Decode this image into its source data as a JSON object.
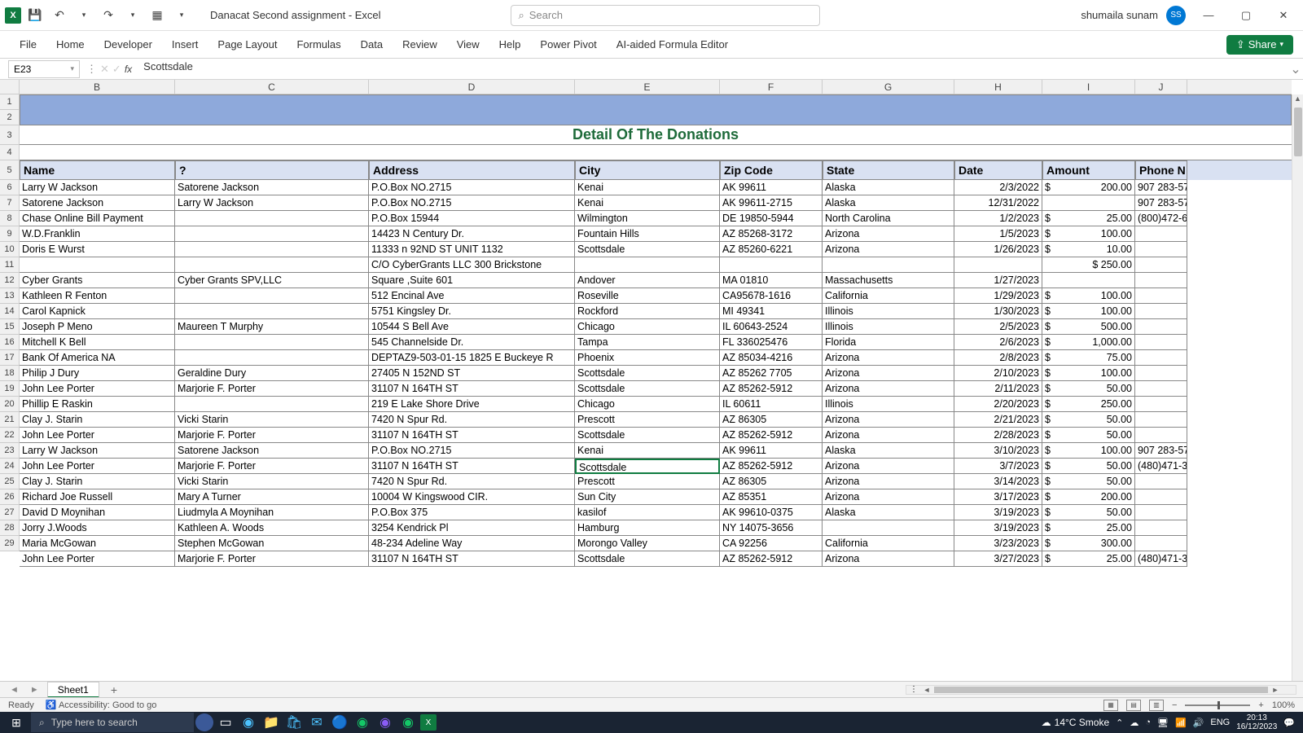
{
  "title_bar": {
    "doc_title": "Danacat Second assignment  -  Excel",
    "search_placeholder": "Search",
    "user_name": "shumaila sunam",
    "avatar": "SS"
  },
  "ribbon_tabs": [
    "File",
    "Home",
    "Developer",
    "Insert",
    "Page Layout",
    "Formulas",
    "Data",
    "Review",
    "View",
    "Help",
    "Power Pivot",
    "AI-aided Formula Editor"
  ],
  "share_label": "Share",
  "name_box": "E23",
  "formula_value": "Scottsdale",
  "col_letters": [
    "B",
    "C",
    "D",
    "E",
    "F",
    "G",
    "H",
    "I",
    "J"
  ],
  "sheet_title": "Detail Of The Donations",
  "headers": [
    "Name",
    "?",
    "Address",
    "City",
    "Zip Code",
    "State",
    "Date",
    "Amount",
    "Phone N"
  ],
  "rows": [
    {
      "r": 6,
      "name": "Larry W Jackson",
      "c2": "Satorene Jackson",
      "addr": "P.O.Box NO.2715",
      "city": "Kenai",
      "zip": "AK 99611",
      "state": "Alaska",
      "date": "2/3/2022",
      "amt": "200.00",
      "phone": "907 283-57"
    },
    {
      "r": 7,
      "name": "Satorene Jackson",
      "c2": "Larry W Jackson",
      "addr": "P.O.Box NO.2715",
      "city": "Kenai",
      "zip": "AK 99611-2715",
      "state": "Alaska",
      "date": "12/31/2022",
      "amt": "",
      "phone": "907 283-57"
    },
    {
      "r": 8,
      "name": "Chase Online Bill Payment",
      "c2": "",
      "addr": "P.O.Box 15944",
      "city": "Wilmington",
      "zip": "DE 19850-5944",
      "state": "North Carolina",
      "date": "1/2/2023",
      "amt": "25.00",
      "phone": "(800)472-6"
    },
    {
      "r": 9,
      "name": "W.D.Franklin",
      "c2": "",
      "addr": "14423 N  Century Dr.",
      "city": "Fountain Hills",
      "zip": "AZ 85268-3172",
      "state": "Arizona",
      "date": "1/5/2023",
      "amt": "100.00",
      "phone": ""
    },
    {
      "r": 10,
      "name": "Doris E Wurst",
      "c2": "",
      "addr": "11333 n 92ND ST UNIT 1132",
      "city": "Scottsdale",
      "zip": "AZ 85260-6221",
      "state": "Arizona",
      "date": "1/26/2023",
      "amt": "10.00",
      "phone": ""
    },
    {
      "r": 11,
      "name": "Cyber Grants",
      "c2": "Cyber Grants SPV,LLC",
      "addr": "C/O CyberGrants LLC 300 Brickstone Square ,Suite 601",
      "city": "Andover",
      "zip": "MA 01810",
      "state": "Massachusetts",
      "date": "1/27/2023",
      "amt": "250.00",
      "phone": "",
      "tall": true,
      "amt_row_above": true
    },
    {
      "r": 12,
      "name": "Kathleen R Fenton",
      "c2": "",
      "addr": "512 Encinal Ave",
      "city": "Roseville",
      "zip": "CA95678-1616",
      "state": "California",
      "date": "1/29/2023",
      "amt": "100.00",
      "phone": ""
    },
    {
      "r": 13,
      "name": "Carol Kapnick",
      "c2": "",
      "addr": "5751 Kingsley Dr.",
      "city": "Rockford",
      "zip": "MI 49341",
      "state": "Illinois",
      "date": "1/30/2023",
      "amt": "100.00",
      "phone": ""
    },
    {
      "r": 14,
      "name": "Joseph P Meno",
      "c2": "Maureen T Murphy",
      "addr": "10544 S Bell Ave",
      "city": "Chicago",
      "zip": "IL 60643-2524",
      "state": "Illinois",
      "date": "2/5/2023",
      "amt": "500.00",
      "phone": ""
    },
    {
      "r": 15,
      "name": "Mitchell K Bell",
      "c2": "",
      "addr": "545 Channelside Dr.",
      "city": "Tampa",
      "zip": "FL 336025476",
      "state": "Florida",
      "date": "2/6/2023",
      "amt": "1,000.00",
      "phone": ""
    },
    {
      "r": 16,
      "name": "Bank Of America NA",
      "c2": "",
      "addr": "DEPTAZ9-503-01-15 1825 E Buckeye R",
      "city": "Phoenix",
      "zip": "AZ 85034-4216",
      "state": "Arizona",
      "date": "2/8/2023",
      "amt": "75.00",
      "phone": ""
    },
    {
      "r": 17,
      "name": "Philip J Dury",
      "c2": "Geraldine Dury",
      "addr": "27405 N 152ND ST",
      "city": "Scottsdale",
      "zip": "AZ 85262 7705",
      "state": "Arizona",
      "date": "2/10/2023",
      "amt": "100.00",
      "phone": ""
    },
    {
      "r": 18,
      "name": "John Lee Porter",
      "c2": "Marjorie F. Porter",
      "addr": "31107 N 164TH ST",
      "city": "Scottsdale",
      "zip": "AZ 85262-5912",
      "state": "Arizona",
      "date": "2/11/2023",
      "amt": "50.00",
      "phone": ""
    },
    {
      "r": 19,
      "name": "Phillip E Raskin",
      "c2": "",
      "addr": "219 E Lake Shore Drive",
      "city": "Chicago",
      "zip": "IL 60611",
      "state": "Illinois",
      "date": "2/20/2023",
      "amt": "250.00",
      "phone": ""
    },
    {
      "r": 20,
      "name": "Clay J. Starin",
      "c2": "Vicki Starin",
      "addr": "7420 N Spur Rd.",
      "city": "Prescott",
      "zip": "AZ 86305",
      "state": "Arizona",
      "date": "2/21/2023",
      "amt": "50.00",
      "phone": ""
    },
    {
      "r": 21,
      "name": "John Lee Porter",
      "c2": "Marjorie F. Porter",
      "addr": "31107 N 164TH ST",
      "city": "Scottsdale",
      "zip": "AZ 85262-5912",
      "state": "Arizona",
      "date": "2/28/2023",
      "amt": "50.00",
      "phone": ""
    },
    {
      "r": 22,
      "name": "Larry W Jackson",
      "c2": "Satorene Jackson",
      "addr": "P.O.Box NO.2715",
      "city": "Kenai",
      "zip": "AK 99611",
      "state": "Alaska",
      "date": "3/10/2023",
      "amt": "100.00",
      "phone": "907 283-57"
    },
    {
      "r": 23,
      "name": "John Lee Porter",
      "c2": "Marjorie F. Porter",
      "addr": "31107 N 164TH ST",
      "city": "Scottsdale",
      "zip": "AZ 85262-5912",
      "state": "Arizona",
      "date": "3/7/2023",
      "amt": "50.00",
      "phone": "(480)471-3",
      "selected": true
    },
    {
      "r": 24,
      "name": "Clay J. Starin",
      "c2": "Vicki Starin",
      "addr": "7420 N Spur Rd.",
      "city": "Prescott",
      "zip": "AZ 86305",
      "state": "Arizona",
      "date": "3/14/2023",
      "amt": "50.00",
      "phone": ""
    },
    {
      "r": 25,
      "name": "Richard Joe Russell",
      "c2": "Mary A Turner",
      "addr": "10004 W Kingswood CIR.",
      "city": "Sun City",
      "zip": "AZ 85351",
      "state": "Arizona",
      "date": "3/17/2023",
      "amt": "200.00",
      "phone": ""
    },
    {
      "r": 26,
      "name": "David D Moynihan",
      "c2": "Liudmyla A Moynihan",
      "addr": "P.O.Box 375",
      "city": "kasilof",
      "zip": "AK 99610-0375",
      "state": "Alaska",
      "date": "3/19/2023",
      "amt": "50.00",
      "phone": ""
    },
    {
      "r": 27,
      "name": "Jorry J.Woods",
      "c2": "Kathleen A. Woods",
      "addr": "3254 Kendrick Pl",
      "city": "Hamburg",
      "zip": "NY 14075-3656",
      "state": "",
      "date": "3/19/2023",
      "amt": "25.00",
      "phone": ""
    },
    {
      "r": 28,
      "name": "Maria McGowan",
      "c2": "Stephen McGowan",
      "addr": "48-234 Adeline Way",
      "city": "Morongo Valley",
      "zip": "CA 92256",
      "state": "California",
      "date": "3/23/2023",
      "amt": "300.00",
      "phone": ""
    },
    {
      "r": 29,
      "name": "John Lee Porter",
      "c2": "Marjorie F. Porter",
      "addr": "31107 N 164TH ST",
      "city": "Scottsdale",
      "zip": "AZ 85262-5912",
      "state": "Arizona",
      "date": "3/27/2023",
      "amt": "25.00",
      "phone": "(480)471-3"
    }
  ],
  "sheet_tab": "Sheet1",
  "status_ready": "Ready",
  "status_access": "Accessibility: Good to go",
  "zoom": "100%",
  "taskbar": {
    "search": "Type here to search",
    "weather": "14°C  Smoke",
    "lang": "ENG",
    "time": "20:13",
    "date": "16/12/2023"
  }
}
